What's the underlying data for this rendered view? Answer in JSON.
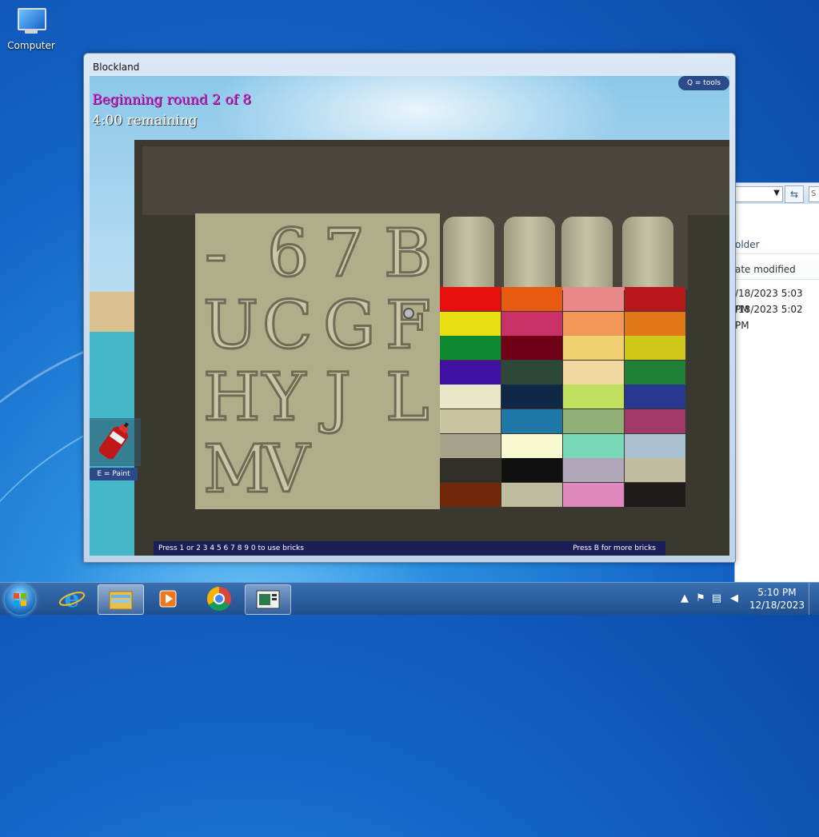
{
  "desktop": {
    "icons": [
      {
        "label": "Computer",
        "icon": "computer-icon"
      }
    ]
  },
  "explorer": {
    "header": "older",
    "column": "ate modified",
    "rows": [
      "/18/2023 5:03 PM",
      "/18/2023 5:02 PM"
    ],
    "search_placeholder": "S"
  },
  "game_window": {
    "title": "Blockland",
    "hud": {
      "round": "Beginning round 2 of 8",
      "time": "4:00 remaining",
      "tools_hint": "Q = tools",
      "paint_hint": "E = Paint",
      "bricks_hint": "Press 1 or  2 3 4 5 6 7 8 9 0 to use bricks",
      "more_bricks": "Press B for more bricks"
    },
    "letters": [
      "-",
      "6",
      "7",
      "B",
      "U",
      "C",
      "G",
      "F",
      "H",
      "Y",
      "J",
      "L",
      "M",
      "V"
    ],
    "palette_colors": [
      [
        "#e8100c",
        "#e85a10",
        "#e88888",
        "#b8181c"
      ],
      [
        "#e8e010",
        "#c83068",
        "#f09858",
        "#e07818"
      ],
      [
        "#108830",
        "#700018",
        "#f0d070",
        "#d0c818"
      ],
      [
        "#4010a0",
        "#2c4838",
        "#f0d8a0",
        "#208038"
      ],
      [
        "#e8e8c8",
        "#102848",
        "#c0e060",
        "#283890"
      ],
      [
        "#c8c4a0",
        "#2078a8",
        "#90b078",
        "#a03868"
      ],
      [
        "#a8a48c",
        "#f8f8d0",
        "#78d8b8",
        "#a8c0d0"
      ],
      [
        "#303028",
        "#101010",
        "#b0a8b8",
        "#c0bca0"
      ],
      [
        "#702808",
        "#c0bca0",
        "#e088c0",
        "#201c1c"
      ]
    ]
  },
  "taskbar": {
    "apps": [
      "start-orb",
      "internet-explorer-icon",
      "file-explorer-icon",
      "media-player-icon",
      "chrome-icon",
      "blockland-icon"
    ],
    "time": "5:10 PM",
    "date": "12/18/2023"
  }
}
